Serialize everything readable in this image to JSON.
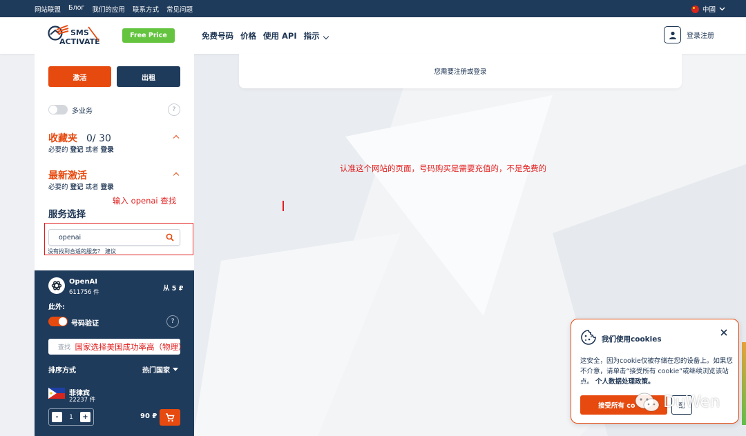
{
  "topbar": {
    "links": [
      "网站联盟",
      "Блог",
      "我们的应用",
      "联系方式",
      "常见问题"
    ],
    "language": "中國"
  },
  "header": {
    "logo_text_top": "SMS",
    "logo_text_bottom": "ACTIVATE",
    "free_price": "Free Price",
    "nav": [
      "免费号码",
      "价格",
      "使用 API",
      "指示"
    ],
    "login": "登录注册"
  },
  "sidebar": {
    "activate": "激活",
    "rent": "出租",
    "multi_service": "多业务",
    "help": "?",
    "favorites": {
      "title": "收藏夹",
      "count": "0/ 30"
    },
    "recent": {
      "title": "最新激活"
    },
    "login_hint": {
      "prefix": "必要的",
      "register": "登记",
      "or": "或者",
      "login": "登录"
    },
    "service_title": "服务选择",
    "search": {
      "value": "openai"
    },
    "suggest": {
      "text": "没有找到合适的服务？",
      "link": "建议"
    }
  },
  "service_panel": {
    "service_name": "OpenAI",
    "service_count": "611756 件",
    "service_price": "从 5 ₽",
    "extra_label": "此外:",
    "verification": "号码验证",
    "help": "?",
    "country_search_placeholder": "查找",
    "sort_label": "排序方式",
    "sort_value": "热门国家",
    "country": {
      "name": "菲律宾",
      "count": "22237 件",
      "quantity": "1",
      "minus": "-",
      "plus": "+",
      "price": "90 ₽"
    }
  },
  "main": {
    "login_banner": "您需要注册或登录"
  },
  "annotations": {
    "search": "输入 openai 查找",
    "country": "国家选择美国成功率高（物理）",
    "main": "认准这个网站的页面，号码购买是需要充值的，不是免费的"
  },
  "cookies": {
    "title": "我们使用cookies",
    "body": "这安全，因为cookie仅被存储在您的设备上。如果您不介意，请单击“接受所有 cookie”或继续浏览该站点。",
    "policy": "个人数据处理政策。",
    "accept": "接受所有 co",
    "second": "配"
  },
  "watermark": "DuWen",
  "colors": {
    "navy": "#1f3b5b",
    "orange": "#e64a0f",
    "green": "#64c43f",
    "annotation_red": "#e11d1d"
  }
}
